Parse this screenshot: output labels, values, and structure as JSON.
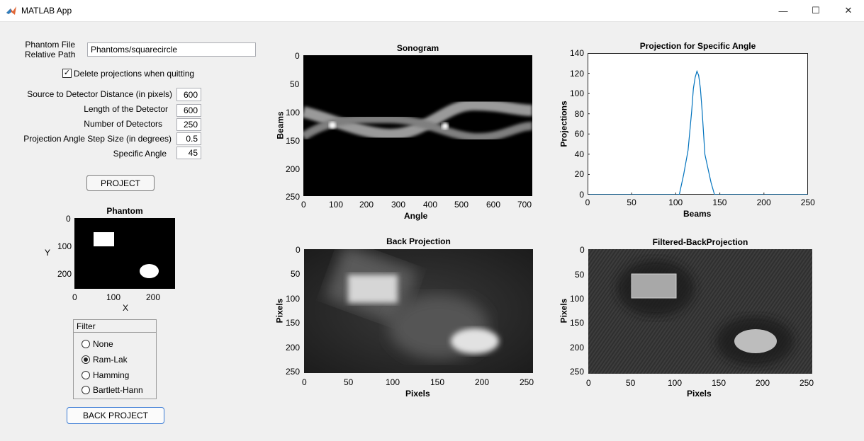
{
  "window": {
    "title": "MATLAB App",
    "minimize": "—",
    "maximize": "☐",
    "close": "✕"
  },
  "controls": {
    "phantom_file_label_1": "Phantom File",
    "phantom_file_label_2": "Relative Path",
    "phantom_file_value": "Phantoms/squarecircle",
    "delete_checkbox_label": "Delete projections when quitting",
    "delete_checked": true,
    "sdd_label": "Source to Detector Distance (in pixels)",
    "sdd_value": "600",
    "detector_length_label": "Length of the Detector",
    "detector_length_value": "600",
    "num_detectors_label": "Number of Detectors",
    "num_detectors_value": "250",
    "angle_step_label": "Projection Angle Step Size (in degrees)",
    "angle_step_value": "0.5",
    "specific_angle_label": "Specific  Angle",
    "specific_angle_value": "45",
    "project_button": "PROJECT",
    "back_project_button": "BACK PROJECT"
  },
  "filter": {
    "title": "Filter",
    "options": [
      "None",
      "Ram-Lak",
      "Hamming",
      "Bartlett-Hann"
    ],
    "selected": "Ram-Lak"
  },
  "phantom_axes": {
    "title": "Phantom",
    "xlabel": "X",
    "ylabel": "Y",
    "xticks": [
      "0",
      "100",
      "200"
    ],
    "yticks": [
      "0",
      "100",
      "200"
    ]
  },
  "sonogram_axes": {
    "title": "Sonogram",
    "xlabel": "Angle",
    "ylabel": "Beams",
    "xticks": [
      "0",
      "100",
      "200",
      "300",
      "400",
      "500",
      "600",
      "700"
    ],
    "yticks": [
      "0",
      "50",
      "100",
      "150",
      "200",
      "250"
    ]
  },
  "backproj_axes": {
    "title": "Back Projection",
    "xlabel": "Pixels",
    "ylabel": "Pixels",
    "xticks": [
      "0",
      "50",
      "100",
      "150",
      "200",
      "250"
    ],
    "yticks": [
      "0",
      "50",
      "100",
      "150",
      "200",
      "250"
    ]
  },
  "fbp_axes": {
    "title": "Filtered-BackProjection",
    "xlabel": "Pixels",
    "ylabel": "Pixels",
    "xticks": [
      "0",
      "50",
      "100",
      "150",
      "200",
      "250"
    ],
    "yticks": [
      "0",
      "50",
      "100",
      "150",
      "200",
      "250"
    ]
  },
  "chart_data": {
    "type": "line",
    "title": "Projection for Specific Angle",
    "xlabel": "Beams",
    "ylabel": "Projections",
    "xlim": [
      0,
      250
    ],
    "ylim": [
      0,
      140
    ],
    "xticks": [
      "0",
      "50",
      "100",
      "150",
      "200",
      "250"
    ],
    "yticks": [
      "0",
      "20",
      "40",
      "60",
      "80",
      "100",
      "120",
      "140"
    ],
    "color": "#0072bd",
    "x": [
      0,
      100,
      104,
      109,
      114,
      118,
      120,
      122,
      124,
      126,
      128,
      130,
      133,
      136,
      140,
      144,
      250
    ],
    "y": [
      0,
      0,
      0,
      20,
      44,
      82,
      105,
      116,
      122,
      118,
      105,
      82,
      40,
      28,
      12,
      0,
      0
    ]
  }
}
